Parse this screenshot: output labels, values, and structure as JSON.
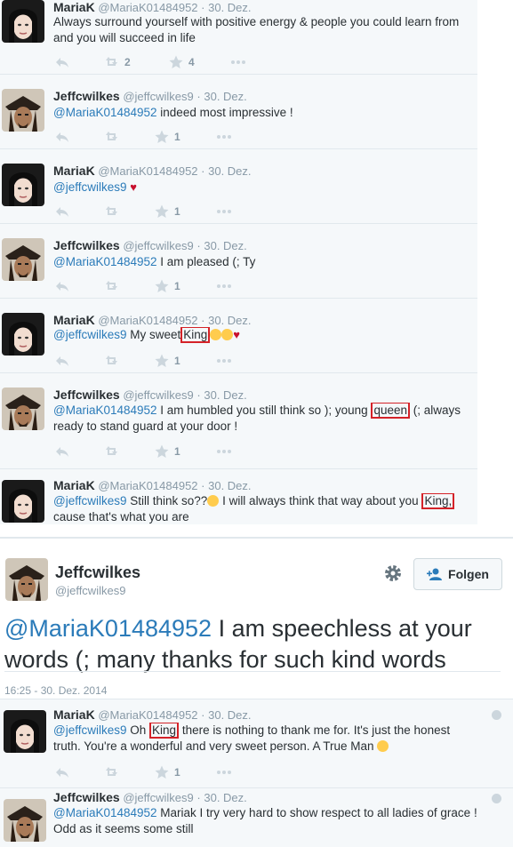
{
  "tweets": [
    {
      "avatar": "mj-avatar",
      "name": "MariaK",
      "handle": "@MariaK01484952",
      "date": "30. Dez.",
      "line1": "Always surround yourself with positive energy & people you could learn from",
      "line2": "and you will succeed in life",
      "retweets": "2",
      "favorites": "4"
    },
    {
      "avatar": "pirate-avatar",
      "name": "Jeffcwilkes",
      "handle": "@jeffcwilkes9",
      "date": "30. Dez.",
      "mention": "@MariaK01484952",
      "text": "indeed most impressive !",
      "favorites": "1"
    },
    {
      "avatar": "mj-avatar",
      "name": "MariaK",
      "handle": "@MariaK01484952",
      "date": "30. Dez.",
      "mention": "@jeffcwilkes9",
      "favorites": "1"
    },
    {
      "avatar": "pirate-avatar",
      "name": "Jeffcwilkes",
      "handle": "@jeffcwilkes9",
      "date": "30. Dez.",
      "mention": "@MariaK01484952",
      "text": "I am pleased (; Ty",
      "favorites": "1"
    },
    {
      "avatar": "mj-avatar",
      "name": "MariaK",
      "handle": "@MariaK01484952",
      "date": "30. Dez.",
      "mention": "@jeffcwilkes9",
      "text_before": "My sweet",
      "highlight": "King",
      "favorites": "1"
    },
    {
      "avatar": "pirate-avatar",
      "name": "Jeffcwilkes",
      "handle": "@jeffcwilkes9",
      "date": "30. Dez.",
      "mention": "@MariaK01484952",
      "text_before": "I am humbled you still think so ); young",
      "highlight": "queen",
      "text_after": "(; always",
      "line2": "ready to stand guard at your door !",
      "favorites": "1"
    },
    {
      "avatar": "mj-avatar",
      "name": "MariaK",
      "handle": "@MariaK01484952",
      "date": "30. Dez.",
      "mention": "@jeffcwilkes9",
      "text_before": "Still think so??",
      "text_mid": "I will always think that way about you",
      "highlight": "King,",
      "line2": "cause that's what you are"
    }
  ],
  "main_tweet": {
    "name": "Jeffcwilkes",
    "handle": "@jeffcwilkes9",
    "follow_label": "Folgen",
    "mention": "@MariaK01484952",
    "text_line1": "I am speechless at your",
    "text_line2": "words (; many thanks for such kind words",
    "timestamp": "16:25 - 30. Dez. 2014"
  },
  "replies": [
    {
      "avatar": "mj-avatar",
      "name": "MariaK",
      "handle": "@MariaK01484952",
      "date": "30. Dez.",
      "mention": "@jeffcwilkes9",
      "text_before": "Oh",
      "highlight": "King",
      "text_after": "there is nothing to thank me for. It's just the honest",
      "line2": "truth. You're a wonderful and very sweet person. A True Man",
      "favorites": "1"
    },
    {
      "avatar": "pirate-avatar",
      "name": "Jeffcwilkes",
      "handle": "@jeffcwilkes9",
      "date": "30. Dez.",
      "mention": "@MariaK01484952",
      "text": "Mariak I try very hard to show respect to all ladies of grace !",
      "line2": "Odd as it seems some still"
    }
  ],
  "colors": {
    "accent": "#2b7bb9",
    "highlight_box": "#d42228",
    "muted": "#8899a6"
  }
}
